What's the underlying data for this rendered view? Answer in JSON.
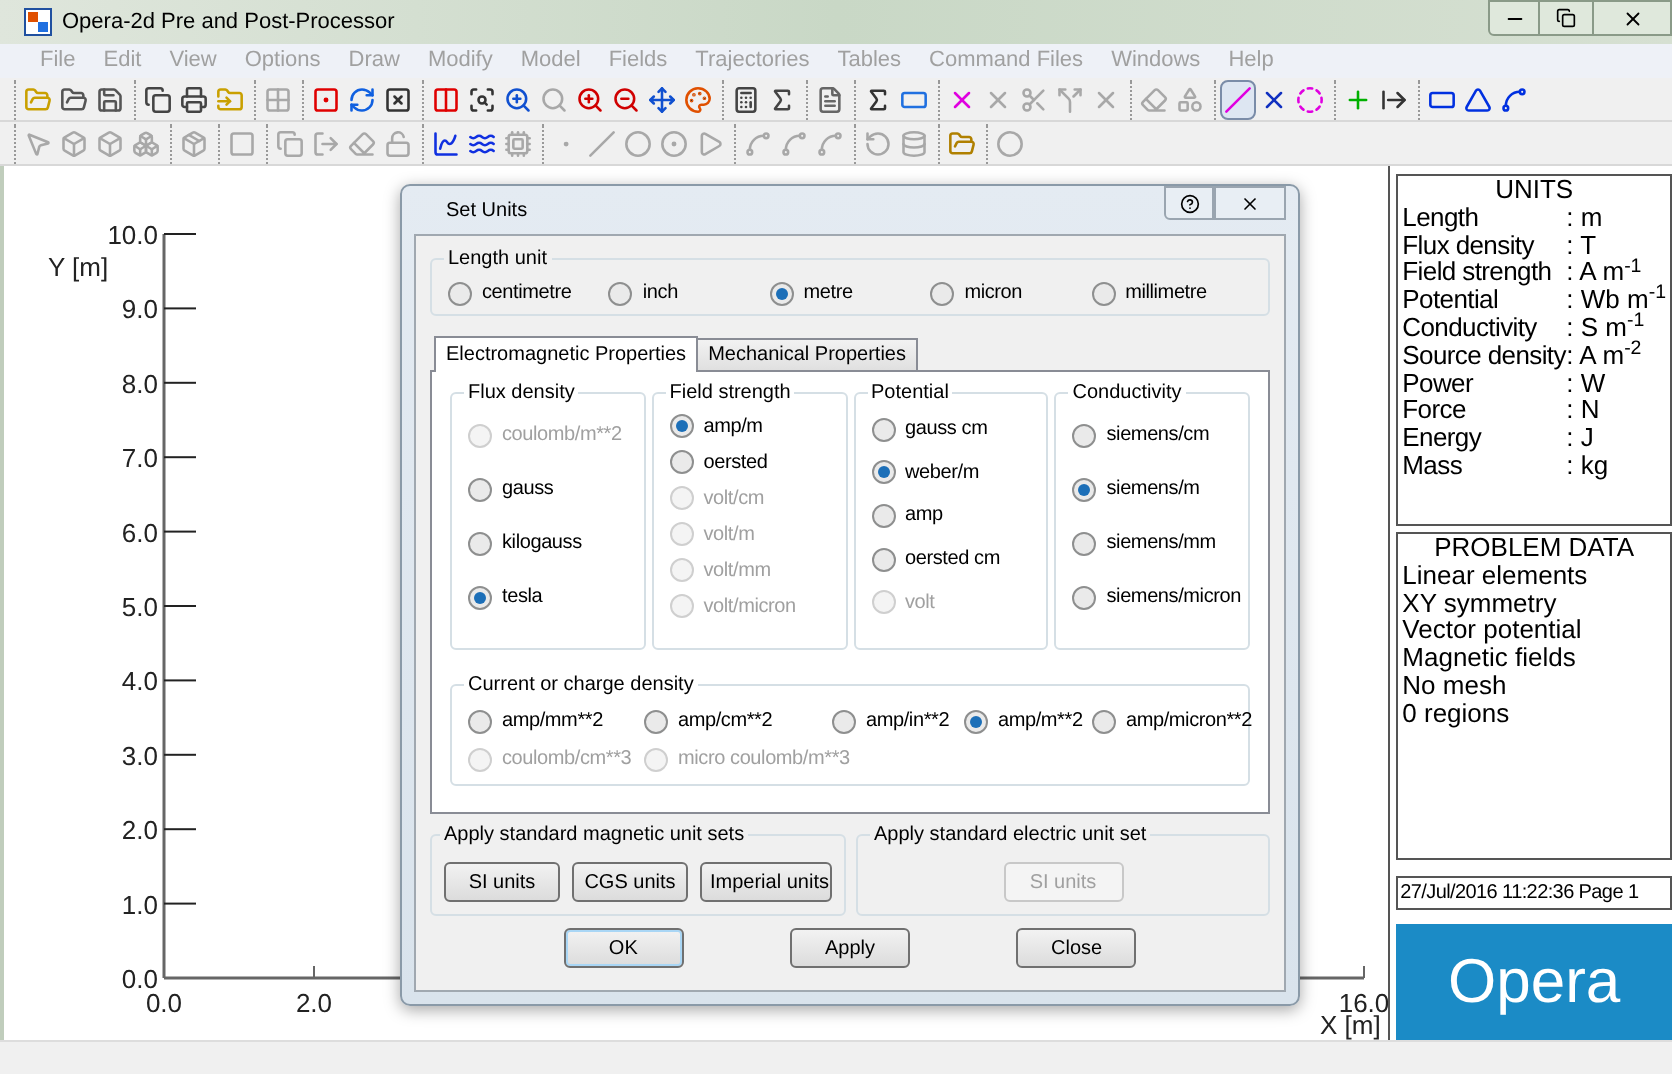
{
  "window": {
    "title": "Opera-2d Pre and Post-Processor"
  },
  "menu": [
    {
      "label": "File",
      "disabled": true
    },
    {
      "label": "Edit",
      "disabled": true
    },
    {
      "label": "View",
      "disabled": true
    },
    {
      "label": "Options",
      "disabled": true
    },
    {
      "label": "Draw",
      "disabled": true
    },
    {
      "label": "Modify",
      "disabled": true
    },
    {
      "label": "Model",
      "disabled": true
    },
    {
      "label": "Fields",
      "disabled": true
    },
    {
      "label": "Trajectories",
      "disabled": true
    },
    {
      "label": "Tables",
      "disabled": true
    },
    {
      "label": "Command Files",
      "disabled": true
    },
    {
      "label": "Windows",
      "disabled": true
    },
    {
      "label": "Help",
      "disabled": true
    }
  ],
  "toolbars": [
    {
      "groups": [
        {
          "tools": [
            {
              "selected": false,
              "disabled": false
            },
            {
              "selected": false,
              "disabled": false
            },
            {
              "selected": false,
              "disabled": false
            }
          ]
        },
        {
          "tools": [
            {
              "selected": false,
              "disabled": false
            },
            {
              "selected": false,
              "disabled": false
            },
            {
              "selected": false,
              "disabled": false
            }
          ]
        },
        {
          "tools": [
            {
              "selected": false,
              "disabled": true
            }
          ]
        },
        {
          "tools": [
            {
              "selected": false,
              "disabled": false
            },
            {
              "selected": false,
              "disabled": false
            },
            {
              "selected": false,
              "disabled": false
            }
          ]
        },
        {
          "tools": [
            {
              "selected": false,
              "disabled": false
            },
            {
              "selected": false,
              "disabled": false
            },
            {
              "selected": false,
              "disabled": false
            },
            {
              "selected": false,
              "disabled": true
            },
            {
              "selected": false,
              "disabled": false
            },
            {
              "selected": false,
              "disabled": false
            },
            {
              "selected": false,
              "disabled": false
            },
            {
              "selected": false,
              "disabled": false
            }
          ]
        },
        {
          "tools": [
            {
              "selected": false,
              "disabled": false
            },
            {
              "selected": false,
              "disabled": false
            }
          ]
        },
        {
          "tools": [
            {
              "selected": false,
              "disabled": false
            }
          ]
        },
        {
          "tools": [
            {
              "selected": false,
              "disabled": false
            },
            {
              "selected": false,
              "disabled": false
            }
          ]
        },
        {
          "tools": [
            {
              "selected": false,
              "disabled": false
            },
            {
              "selected": false,
              "disabled": true
            },
            {
              "selected": false,
              "disabled": true
            },
            {
              "selected": false,
              "disabled": true
            },
            {
              "selected": false,
              "disabled": true
            }
          ]
        },
        {
          "tools": [
            {
              "selected": false,
              "disabled": true
            },
            {
              "selected": false,
              "disabled": true
            }
          ]
        },
        {
          "tools": [
            {
              "selected": true,
              "disabled": false
            },
            {
              "selected": false,
              "disabled": false
            },
            {
              "selected": false,
              "disabled": false
            }
          ]
        },
        {
          "tools": [
            {
              "selected": false,
              "disabled": false
            },
            {
              "selected": false,
              "disabled": false
            }
          ]
        },
        {
          "tools": [
            {
              "selected": false,
              "disabled": false
            },
            {
              "selected": false,
              "disabled": false
            },
            {
              "selected": false,
              "disabled": false
            }
          ]
        }
      ]
    },
    {
      "groups": [
        {
          "tools": [
            {
              "selected": false,
              "disabled": true
            },
            {
              "selected": false,
              "disabled": true
            },
            {
              "selected": false,
              "disabled": true
            },
            {
              "selected": false,
              "disabled": true
            }
          ]
        },
        {
          "tools": [
            {
              "selected": false,
              "disabled": true
            }
          ]
        },
        {
          "tools": [
            {
              "selected": false,
              "disabled": true
            }
          ]
        },
        {
          "tools": [
            {
              "selected": false,
              "disabled": true
            },
            {
              "selected": false,
              "disabled": true
            },
            {
              "selected": false,
              "disabled": true
            },
            {
              "selected": false,
              "disabled": true
            }
          ]
        },
        {
          "tools": [
            {
              "selected": false,
              "disabled": false
            },
            {
              "selected": false,
              "disabled": false
            },
            {
              "selected": false,
              "disabled": true
            }
          ]
        },
        {
          "tools": [
            {
              "selected": false,
              "disabled": true
            },
            {
              "selected": false,
              "disabled": true
            },
            {
              "selected": false,
              "disabled": true
            },
            {
              "selected": false,
              "disabled": true
            },
            {
              "selected": false,
              "disabled": true
            }
          ]
        },
        {
          "tools": [
            {
              "selected": false,
              "disabled": true
            },
            {
              "selected": false,
              "disabled": true
            },
            {
              "selected": false,
              "disabled": true
            }
          ]
        },
        {
          "tools": [
            {
              "selected": false,
              "disabled": true
            },
            {
              "selected": false,
              "disabled": true
            }
          ]
        },
        {
          "tools": [
            {
              "selected": false,
              "disabled": false
            }
          ]
        },
        {
          "tools": [
            {
              "selected": false,
              "disabled": true
            }
          ]
        }
      ]
    }
  ],
  "plot": {
    "chart_data": {
      "type": "scatter",
      "xlabel": "X [m]",
      "ylabel": "Y [m]",
      "xlim": [
        0,
        16
      ],
      "ylim": [
        0,
        10
      ],
      "xticks": [
        {
          "value": 0,
          "label": "0.0"
        },
        {
          "value": 2,
          "label": "2.0"
        },
        {
          "value": 16,
          "label": "16.0"
        }
      ],
      "yticks": [
        {
          "value": 10,
          "label": "10.0"
        },
        {
          "value": 9,
          "label": "9.0"
        },
        {
          "value": 8,
          "label": "8.0"
        },
        {
          "value": 7,
          "label": "7.0"
        },
        {
          "value": 6,
          "label": "6.0"
        },
        {
          "value": 5,
          "label": "5.0"
        },
        {
          "value": 4,
          "label": "4.0"
        },
        {
          "value": 3,
          "label": "3.0"
        },
        {
          "value": 2,
          "label": "2.0"
        },
        {
          "value": 1,
          "label": "1.0"
        },
        {
          "value": 0,
          "label": "0.0"
        }
      ]
    }
  },
  "dialog": {
    "title": "Set Units",
    "length_unit": {
      "label": "Length unit",
      "options": [
        {
          "label": "centimetre",
          "selected": false,
          "disabled": false
        },
        {
          "label": "inch",
          "selected": false,
          "disabled": false
        },
        {
          "label": "metre",
          "selected": true,
          "disabled": false
        },
        {
          "label": "micron",
          "selected": false,
          "disabled": false
        },
        {
          "label": "millimetre",
          "selected": false,
          "disabled": false
        }
      ]
    },
    "tabs": [
      {
        "label": "Electromagnetic Properties",
        "selected": true
      },
      {
        "label": "Mechanical Properties",
        "selected": false
      }
    ],
    "groups": [
      {
        "label": "Flux density",
        "options": [
          {
            "label": "coulomb/m**2",
            "selected": false,
            "disabled": true
          },
          {
            "label": "gauss",
            "selected": false,
            "disabled": false
          },
          {
            "label": "kilogauss",
            "selected": false,
            "disabled": false
          },
          {
            "label": "tesla",
            "selected": true,
            "disabled": false
          }
        ]
      },
      {
        "label": "Field strength",
        "options": [
          {
            "label": "amp/m",
            "selected": true,
            "disabled": false
          },
          {
            "label": "oersted",
            "selected": false,
            "disabled": false
          },
          {
            "label": "volt/cm",
            "selected": false,
            "disabled": true
          },
          {
            "label": "volt/m",
            "selected": false,
            "disabled": true
          },
          {
            "label": "volt/mm",
            "selected": false,
            "disabled": true
          },
          {
            "label": "volt/micron",
            "selected": false,
            "disabled": true
          }
        ]
      },
      {
        "label": "Potential",
        "options": [
          {
            "label": "gauss cm",
            "selected": false,
            "disabled": false
          },
          {
            "label": "weber/m",
            "selected": true,
            "disabled": false
          },
          {
            "label": "amp",
            "selected": false,
            "disabled": false
          },
          {
            "label": "oersted cm",
            "selected": false,
            "disabled": false
          },
          {
            "label": "volt",
            "selected": false,
            "disabled": true
          }
        ]
      },
      {
        "label": "Conductivity",
        "options": [
          {
            "label": "siemens/cm",
            "selected": false,
            "disabled": false
          },
          {
            "label": "siemens/m",
            "selected": true,
            "disabled": false
          },
          {
            "label": "siemens/mm",
            "selected": false,
            "disabled": false
          },
          {
            "label": "siemens/micron",
            "selected": false,
            "disabled": false
          }
        ]
      }
    ],
    "current_density": {
      "label": "Current or charge density",
      "options": [
        {
          "label": "amp/mm**2",
          "selected": false,
          "disabled": false
        },
        {
          "label": "amp/cm**2",
          "selected": false,
          "disabled": false
        },
        {
          "label": "amp/in**2",
          "selected": false,
          "disabled": false
        },
        {
          "label": "amp/m**2",
          "selected": true,
          "disabled": false
        },
        {
          "label": "amp/micron**2",
          "selected": false,
          "disabled": false
        },
        {
          "label": "coulomb/cm**3",
          "selected": false,
          "disabled": true
        },
        {
          "label": "micro coulomb/m**3",
          "selected": false,
          "disabled": true
        }
      ]
    },
    "magnetic_sets": {
      "label": "Apply standard magnetic unit sets",
      "buttons": [
        {
          "label": "SI units",
          "disabled": false
        },
        {
          "label": "CGS units",
          "disabled": false
        },
        {
          "label": "Imperial units",
          "disabled": false
        }
      ]
    },
    "electric_sets": {
      "label": "Apply standard electric unit set",
      "buttons": [
        {
          "label": "SI units",
          "disabled": true
        }
      ]
    },
    "buttons": [
      {
        "label": "OK",
        "default": true
      },
      {
        "label": "Apply",
        "default": false
      },
      {
        "label": "Close",
        "default": false
      }
    ]
  },
  "units_panel": {
    "title": "UNITS",
    "rows": [
      {
        "label": "Length",
        "value": ": m"
      },
      {
        "label": "Flux density",
        "value": ": T"
      },
      {
        "label": "Field strength",
        "value": ": A m$^{-1}$"
      },
      {
        "label": "Potential",
        "value": ": Wb m$^{-1}$"
      },
      {
        "label": "Conductivity",
        "value": ": S m$^{-1}$"
      },
      {
        "label": "Source density",
        "value": ": A m$^{-2}$"
      },
      {
        "label": "Power",
        "value": ": W"
      },
      {
        "label": "Force",
        "value": ": N"
      },
      {
        "label": "Energy",
        "value": ": J"
      },
      {
        "label": "Mass",
        "value": ": kg"
      }
    ]
  },
  "problem_panel": {
    "title": "PROBLEM DATA",
    "lines": [
      "Linear elements",
      "XY symmetry",
      "Vector potential",
      "Magnetic fields",
      "No mesh",
      "0 regions"
    ]
  },
  "timestamp": "27/Jul/2016 11:22:36 Page 1",
  "logo": {
    "text": "Opera"
  }
}
